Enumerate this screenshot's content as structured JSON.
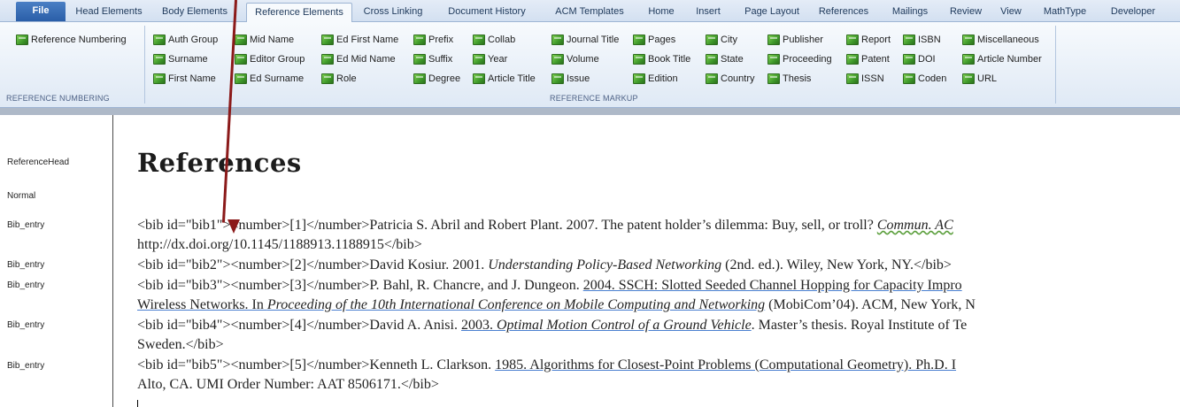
{
  "tabs": [
    {
      "label": "File"
    },
    {
      "label": "Head Elements"
    },
    {
      "label": "Body Elements"
    },
    {
      "label": "Reference Elements"
    },
    {
      "label": "Cross Linking"
    },
    {
      "label": "Document History"
    },
    {
      "label": "ACM Templates"
    },
    {
      "label": "Home"
    },
    {
      "label": "Insert"
    },
    {
      "label": "Page Layout"
    },
    {
      "label": "References"
    },
    {
      "label": "Mailings"
    },
    {
      "label": "Review"
    },
    {
      "label": "View"
    },
    {
      "label": "MathType"
    },
    {
      "label": "Developer"
    }
  ],
  "ribbon": {
    "groups": {
      "numbering_label": "REFERENCE NUMBERING",
      "markup_label": "REFERENCE MARKUP"
    },
    "buttons": {
      "reference_numbering": "Reference Numbering",
      "auth_group": "Auth Group",
      "surname": "Surname",
      "first_name": "First Name",
      "mid_name": "Mid Name",
      "editor_group": "Editor Group",
      "ed_surname": "Ed Surname",
      "ed_first_name": "Ed First Name",
      "ed_mid_name": "Ed Mid Name",
      "role": "Role",
      "prefix": "Prefix",
      "suffix": "Suffix",
      "degree": "Degree",
      "collab": "Collab",
      "year": "Year",
      "article_title": "Article Title",
      "journal_title": "Journal Title",
      "volume": "Volume",
      "issue": "Issue",
      "pages": "Pages",
      "book_title": "Book Title",
      "edition": "Edition",
      "city": "City",
      "state": "State",
      "country": "Country",
      "publisher": "Publisher",
      "proceeding": "Proceeding",
      "thesis": "Thesis",
      "report": "Report",
      "patent": "Patent",
      "issn": "ISSN",
      "isbn": "ISBN",
      "doi": "DOI",
      "coden": "Coden",
      "miscellaneous": "Miscellaneous",
      "article_number": "Article Number",
      "url": "URL"
    }
  },
  "styles": {
    "reference_head": "ReferenceHead",
    "normal": "Normal",
    "bib_entry": "Bib_entry"
  },
  "document": {
    "heading": "References",
    "bib1": {
      "open": "<bib id=\"bib1\"><number>[1]</number>Patricia S. Abril and Robert Plant. 2007. The patent holder’s dilemma: Buy, sell, or troll? ",
      "journal": "Commun. AC",
      "line2": "http://dx.doi.org/10.1145/1188913.1188915</bib>"
    },
    "bib2": {
      "open": "<bib id=\"bib2\"><number>[2]</number>David Kosiur. 2001. ",
      "title": "Understanding Policy-Based Networking",
      "close": " (2nd. ed.). Wiley, New York, NY.</bib>"
    },
    "bib3": {
      "open": "<bib id=\"bib3\"><number>[3]</number>P. Bahl, R. Chancre, and J. Dungeon. ",
      "rest": "2004. SSCH: Slotted Seeded Channel Hopping for Capacity Impro",
      "line2_a": "Wireless Networks. In ",
      "line2_b": "Proceeding of the 10th International Conference on Mobile Computing and Networking",
      "line2_c": " (MobiCom’04). ACM, New York, N"
    },
    "bib4": {
      "open": "<bib id=\"bib4\"><number>[4]</number>David A. Anisi. ",
      "year": "2003. ",
      "title": "Optimal Motion Control of a Ground Vehicle",
      "rest": ". Master’s thesis. Royal Institute of Te",
      "line2": "Sweden.</bib>"
    },
    "bib5": {
      "open": "<bib id=\"bib5\"><number>[5]</number>Kenneth L. Clarkson. ",
      "rest": "1985. Algorithms for Closest-Point Problems (Computational Geometry). Ph.D. I",
      "line2": "Alto, CA. UMI Order Number: AAT 8506171.</bib>"
    }
  },
  "colors": {
    "annotation_arrow": "#8b1a1a",
    "ribbon_icon": "#3f9a2a",
    "file_tab": "#2a5ea8"
  }
}
